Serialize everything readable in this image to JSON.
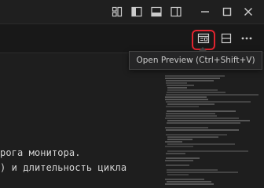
{
  "titlebar": {
    "icons": [
      "customize-layout-icon",
      "toggle-primary-sidebar-icon",
      "toggle-panel-icon",
      "toggle-secondary-sidebar-icon",
      "minimize-icon",
      "maximize-icon",
      "close-icon"
    ]
  },
  "toolbar": {
    "icons": [
      "open-preview-icon",
      "split-editor-icon",
      "more-actions-icon"
    ]
  },
  "tooltip": {
    "text": "Open Preview (Ctrl+Shift+V)"
  },
  "editor": {
    "lines": [
      "рога монитора.",
      ") и длительность цикла"
    ]
  },
  "colors": {
    "highlight": "#e0242f",
    "icon": "#cccccc"
  }
}
